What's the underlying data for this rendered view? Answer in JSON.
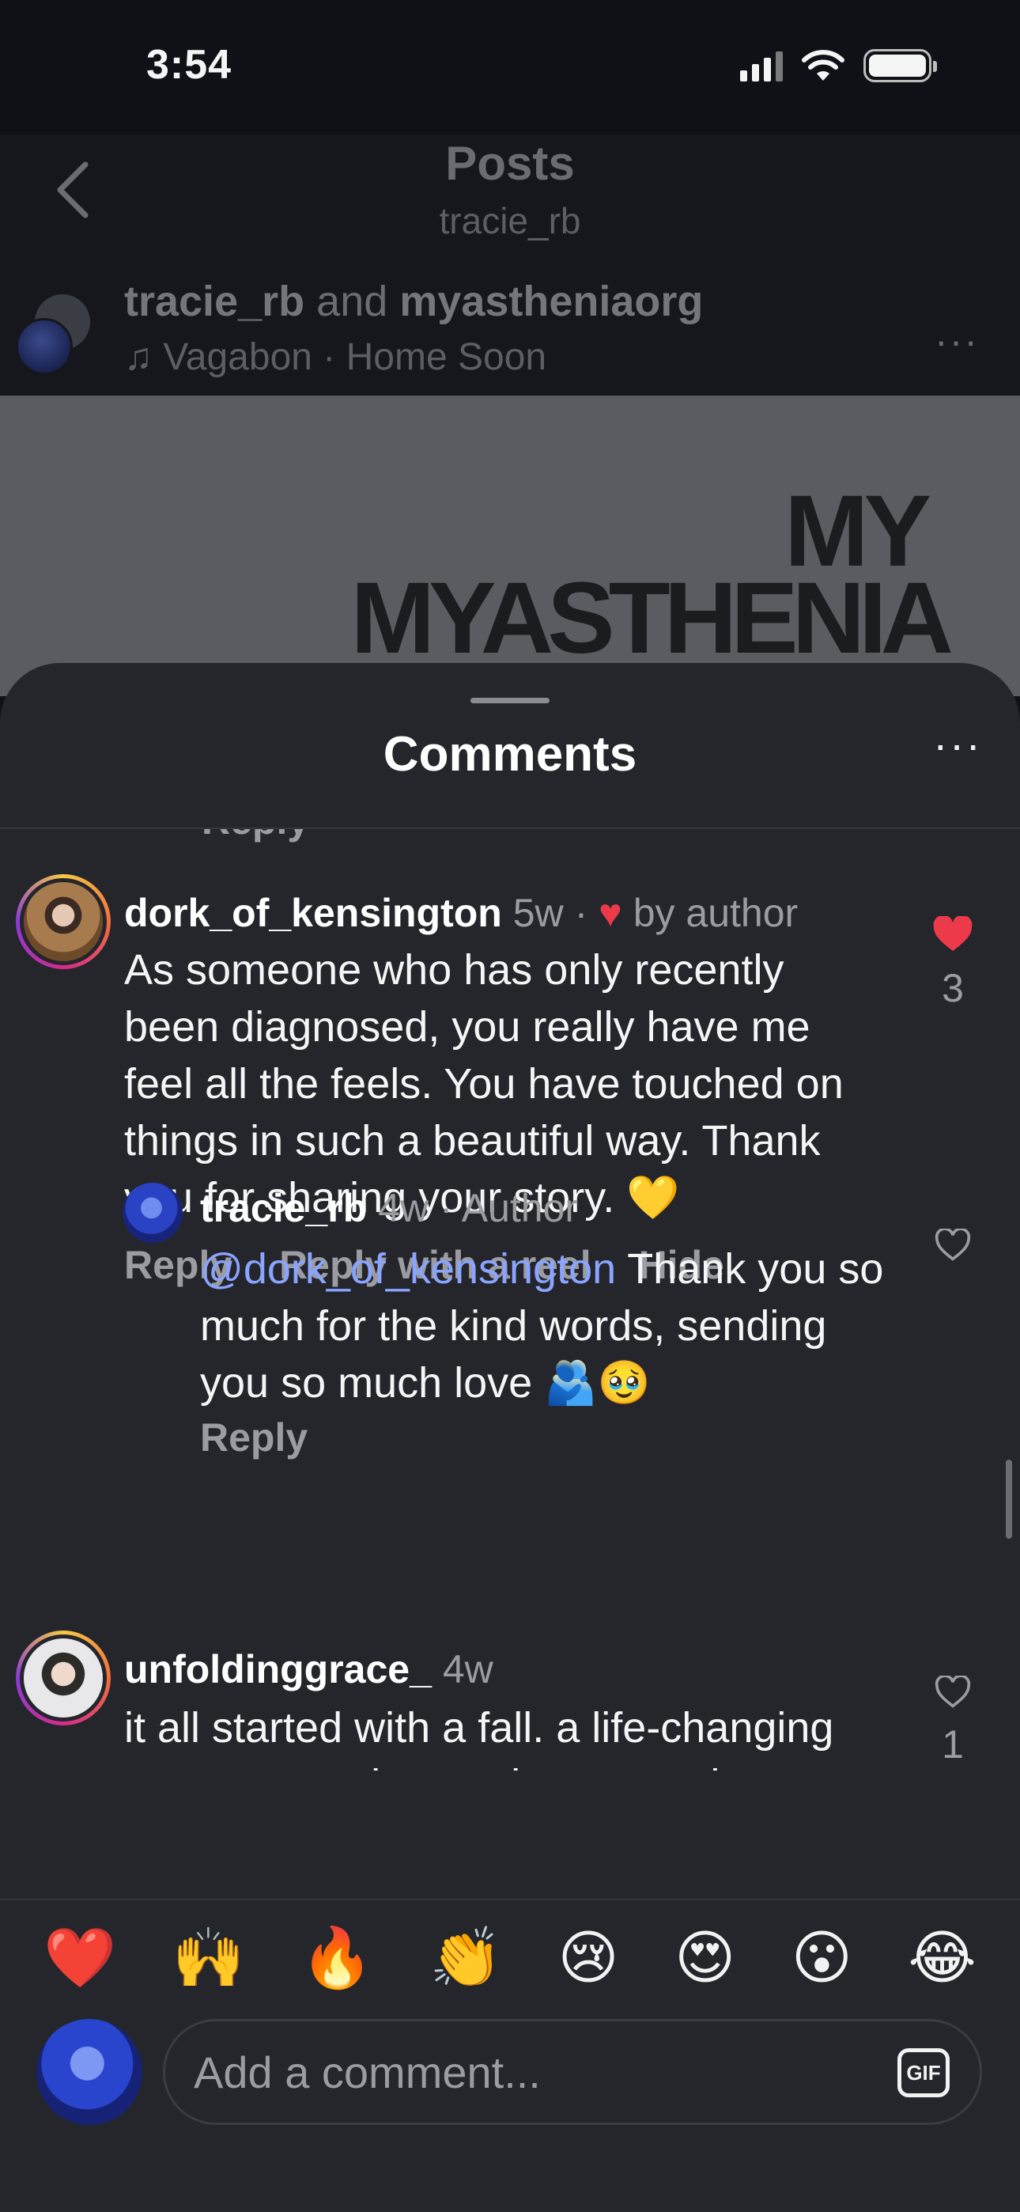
{
  "status_bar": {
    "time": "3:54"
  },
  "post_header": {
    "title": "Posts",
    "subtitle": "tracie_rb",
    "author_primary": "tracie_rb",
    "author_joiner": "and",
    "author_secondary": "myastheniaorg",
    "music": "♫ Vagabon · Home Soon",
    "more": "···"
  },
  "post_image": {
    "line1": "MY",
    "line2": "MYASTHENIA"
  },
  "sheet": {
    "title": "Comments",
    "more": "···",
    "cut_off_reply": "Reply"
  },
  "comments": [
    {
      "username": "dork_of_kensington",
      "time": "5w",
      "separator": " · ",
      "author_heart": "♥",
      "author_label": " by author",
      "body": "As someone who has only recently been diagnosed, you really have me feel all the feels. You have touched on things in such a beautiful way. Thank you for sharing your story. 💛",
      "actions": [
        "Reply",
        "Reply with a reel",
        "Hide"
      ],
      "likes": "3",
      "liked": true
    },
    {
      "username": "tracie_rb",
      "time": "4w",
      "badge": " · Author",
      "mention": "@dork_of_kensington",
      "body": " Thank you so much for the kind words, sending you so much love 🫂🥹",
      "actions": [
        "Reply"
      ],
      "liked": false
    },
    {
      "username": "unfoldinggrace_",
      "time": "4w",
      "body": "it all started with a fall. a life-changing moment so eloquently captured. your story is a reflection of mine--with shared struggles",
      "likes": "1",
      "liked": false
    }
  ],
  "reactions": [
    "❤️",
    "🙌",
    "🔥",
    "👏",
    "😢",
    "😍",
    "😮",
    "😂"
  ],
  "composer": {
    "placeholder": "Add a comment...",
    "gif_label": "GIF"
  },
  "colors": {
    "sheet_bg": "#24262c",
    "like_red": "#ed3a4b",
    "mention_blue": "#8aa4ff"
  },
  "icons": [
    "back-chevron-icon",
    "signal-icon",
    "wifi-icon",
    "battery-icon",
    "heart-icon",
    "heart-outline-icon",
    "gif-icon",
    "more-icon"
  ]
}
